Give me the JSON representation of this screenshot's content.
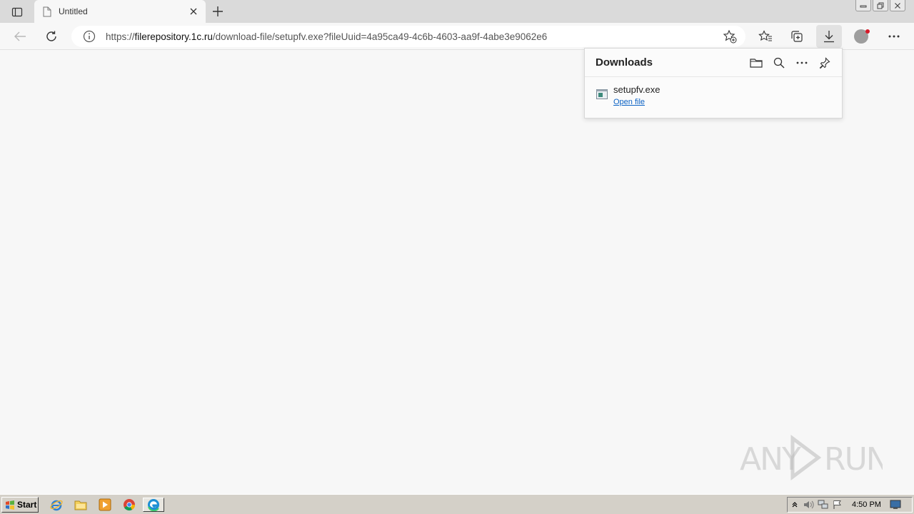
{
  "tab": {
    "title": "Untitled"
  },
  "address": {
    "scheme": "https://",
    "host": "filerepository.1c.ru",
    "path": "/download-file/setupfv.exe?fileUuid=4a95ca49-4c6b-4603-aa9f-4abe3e9062e6"
  },
  "downloads": {
    "title": "Downloads",
    "items": [
      {
        "name": "setupfv.exe",
        "action": "Open file"
      }
    ]
  },
  "watermark": {
    "text": "ANY RUN"
  },
  "taskbar": {
    "start_label": "Start",
    "clock": "4:50 PM"
  },
  "colors": {
    "page_bg": "#f7f7f7",
    "tabstrip_bg": "#dadada",
    "link": "#0b62c4",
    "taskbar_bg": "#d4d0c8"
  }
}
